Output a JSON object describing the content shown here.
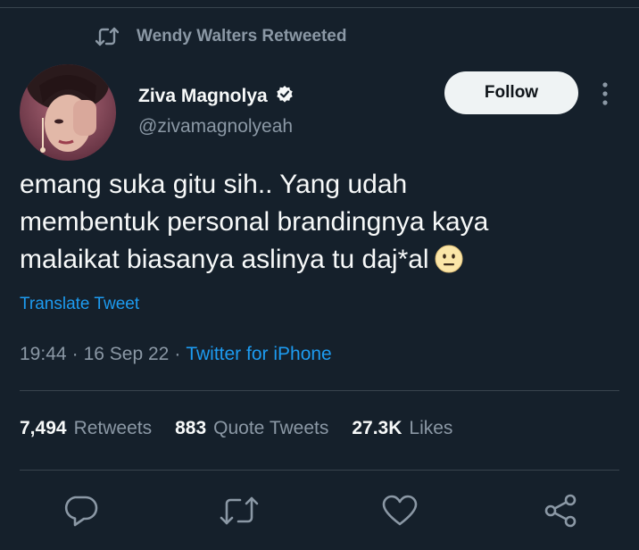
{
  "context": {
    "retweeted_by": "Wendy Walters Retweeted"
  },
  "author": {
    "name": "Ziva Magnolya",
    "handle": "@zivamagnolyeah",
    "verified": true
  },
  "follow_label": "Follow",
  "tweet": {
    "lines": [
      "emang suka gitu sih.. Yang udah",
      "membentuk personal brandingnya kaya",
      "malaikat biasanya aslinya tu daj*al"
    ],
    "emoji": "neutral-face-emoji"
  },
  "translate_label": "Translate Tweet",
  "meta": {
    "time": "19:44",
    "sep1": "·",
    "date": "16 Sep 22",
    "sep2": "·",
    "source": "Twitter for iPhone"
  },
  "stats": [
    {
      "count": "7,494",
      "label": "Retweets"
    },
    {
      "count": "883",
      "label": "Quote Tweets"
    },
    {
      "count": "27.3K",
      "label": "Likes"
    }
  ],
  "actions": [
    "reply-icon",
    "retweet-icon",
    "like-icon",
    "share-icon"
  ],
  "colors": {
    "background": "#15202b",
    "text": "#f7f9f9",
    "secondary": "#8b98a5",
    "accent": "#1d9bf0",
    "divider": "#38444d"
  }
}
